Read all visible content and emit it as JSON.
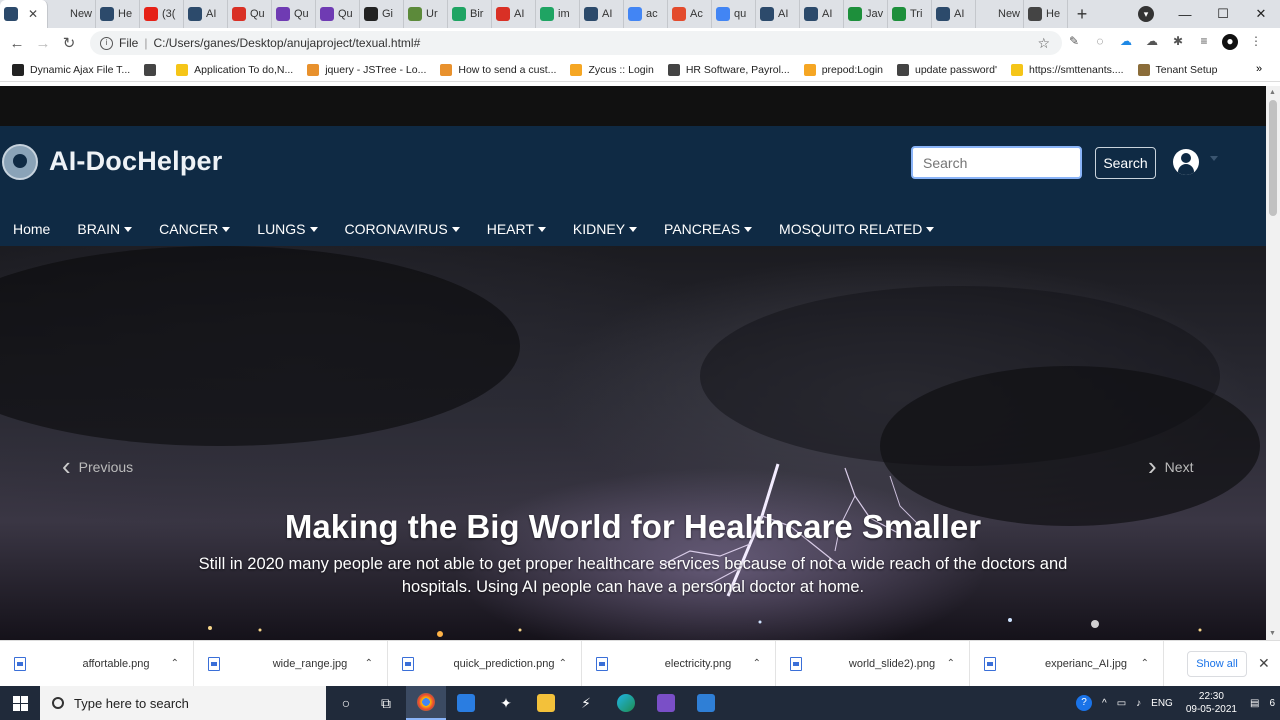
{
  "browser": {
    "tabs": [
      {
        "label": "",
        "color": "#2c4a6b",
        "active": true
      },
      {
        "label": "New Ta",
        "color": ""
      },
      {
        "label": "He",
        "color": "#2c4a6b"
      },
      {
        "label": "(3(",
        "color": "#e62117"
      },
      {
        "label": "AI",
        "color": "#2c4a6b"
      },
      {
        "label": "Qu",
        "color": "#d93025"
      },
      {
        "label": "Qu",
        "color": "#6f3bb3"
      },
      {
        "label": "Qu",
        "color": "#6f3bb3"
      },
      {
        "label": "Gi",
        "color": "#222"
      },
      {
        "label": "Ur",
        "color": "#5c8a3a"
      },
      {
        "label": "Bir",
        "color": "#1fa463"
      },
      {
        "label": "AI",
        "color": "#d93025"
      },
      {
        "label": "im",
        "color": "#1fa463"
      },
      {
        "label": "AI",
        "color": "#2c4a6b"
      },
      {
        "label": "ac",
        "color": "#4285f4"
      },
      {
        "label": "Ac",
        "color": "#e34b2d"
      },
      {
        "label": "qu",
        "color": "#4285f4"
      },
      {
        "label": "AI",
        "color": "#2c4a6b"
      },
      {
        "label": "AI",
        "color": "#2c4a6b"
      },
      {
        "label": "Jav",
        "color": "#1d8f3b"
      },
      {
        "label": "Tri",
        "color": "#1d8f3b"
      },
      {
        "label": "AI",
        "color": "#2c4a6b"
      },
      {
        "label": "New Ta",
        "color": ""
      },
      {
        "label": "He",
        "color": "#444"
      }
    ],
    "new_tab": "+",
    "window_controls": {
      "minimize": "—",
      "maximize": "☐",
      "close": "✕"
    },
    "url_prefix": "File",
    "url": "C:/Users/ganes/Desktop/anujaproject/texual.html#",
    "bookmarks": [
      {
        "label": "Dynamic Ajax File T...",
        "color": "#222"
      },
      {
        "label": "",
        "color": "#444"
      },
      {
        "label": "Application To do,N...",
        "color": "#f5c518"
      },
      {
        "label": "jquery - JSTree - Lo...",
        "color": "#e8912d"
      },
      {
        "label": "How to send a cust...",
        "color": "#e8912d"
      },
      {
        "label": "Zycus :: Login",
        "color": "#f5a623"
      },
      {
        "label": "HR Software, Payrol...",
        "color": "#444"
      },
      {
        "label": "prepod:Login",
        "color": "#f5a623"
      },
      {
        "label": "update password'",
        "color": "#444"
      },
      {
        "label": "https://smttenants....",
        "color": "#f5c518"
      },
      {
        "label": "Tenant Setup",
        "color": "#8b6d3a"
      }
    ],
    "bookmarks_more": "»"
  },
  "site": {
    "brand": "AI-DocHelper",
    "search_placeholder": "Search",
    "search_button": "Search",
    "nav": [
      {
        "label": "Home",
        "dropdown": false
      },
      {
        "label": "BRAIN",
        "dropdown": true
      },
      {
        "label": "CANCER",
        "dropdown": true
      },
      {
        "label": "LUNGS",
        "dropdown": true
      },
      {
        "label": "CORONAVIRUS",
        "dropdown": true
      },
      {
        "label": "HEART",
        "dropdown": true
      },
      {
        "label": "KIDNEY",
        "dropdown": true
      },
      {
        "label": "PANCREAS",
        "dropdown": true
      },
      {
        "label": "MOSQUITO RELATED",
        "dropdown": true
      }
    ],
    "carousel": {
      "prev": "Previous",
      "next": "Next",
      "title": "Making the Big World for Healthcare Smaller",
      "subtitle": "Still in 2020 many people are not able to get proper healthcare services because of not a wide reach of the doctors and hospitals. Using AI people can have a personal doctor at home."
    }
  },
  "downloads": {
    "items": [
      "affortable.png",
      "wide_range.jpg",
      "quick_prediction.png",
      "electricity.png",
      "world_slide2).png",
      "experianc_AI.jpg"
    ],
    "show_all": "Show all"
  },
  "taskbar": {
    "search_placeholder": "Type here to search",
    "language": "ENG",
    "time": "22:30",
    "date": "09-05-2021",
    "notifications": "6"
  }
}
